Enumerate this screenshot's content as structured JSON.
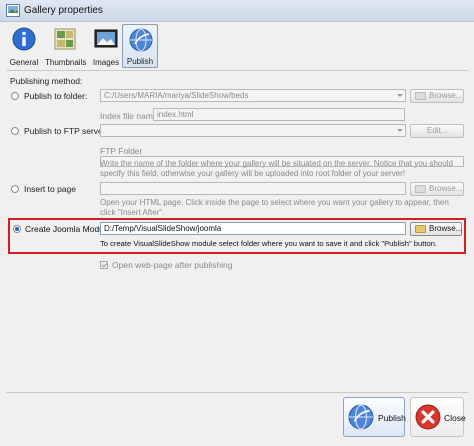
{
  "window": {
    "title": "Gallery properties"
  },
  "toolbar": {
    "tabs": [
      {
        "label": "General",
        "icon": "info-icon"
      },
      {
        "label": "Thumbnails",
        "icon": "thumbnails-icon"
      },
      {
        "label": "Images",
        "icon": "images-icon"
      },
      {
        "label": "Publish",
        "icon": "publish-globe-icon",
        "active": true
      }
    ]
  },
  "publishing": {
    "method_label": "Publishing method:",
    "folder": {
      "option_label": "Publish to folder:",
      "path_value": "C:/Users/MARIA/mariya/SlideShow/beds",
      "browse_label": "Browse...",
      "index_label": "Index file name",
      "index_value": "index.html"
    },
    "ftp": {
      "option_label": "Publish to FTP server",
      "server_value": "",
      "edit_label": "Edit...",
      "folder_label": "FTP Folder",
      "folder_value": "",
      "note": "Write the name of the folder where your gallery will be situated on the server. Notice that you should specify this field, otherwise your gallery will be uploaded into root folder of your server!"
    },
    "page": {
      "option_label": "Insert to page",
      "page_value": "",
      "browse_label": "Browse...",
      "note": "Open your HTML page. Click inside the page to select where you want your gallery to appear, then click \"Insert After\"."
    },
    "joomla": {
      "option_label": "Create Joomla Module",
      "path_value": "D:/Temp/VisualSlideShow/joomla",
      "browse_label": "Browse...",
      "note": "To create VisualSlideShow module select folder where you want to save it and click \"Publish\" button.",
      "selected": true
    },
    "open_after_label": "Open web-page after publishing"
  },
  "footer": {
    "publish_label": "Publish",
    "close_label": "Close"
  },
  "colors": {
    "highlight": "#d31f1f",
    "accent": "#2b62c4"
  }
}
